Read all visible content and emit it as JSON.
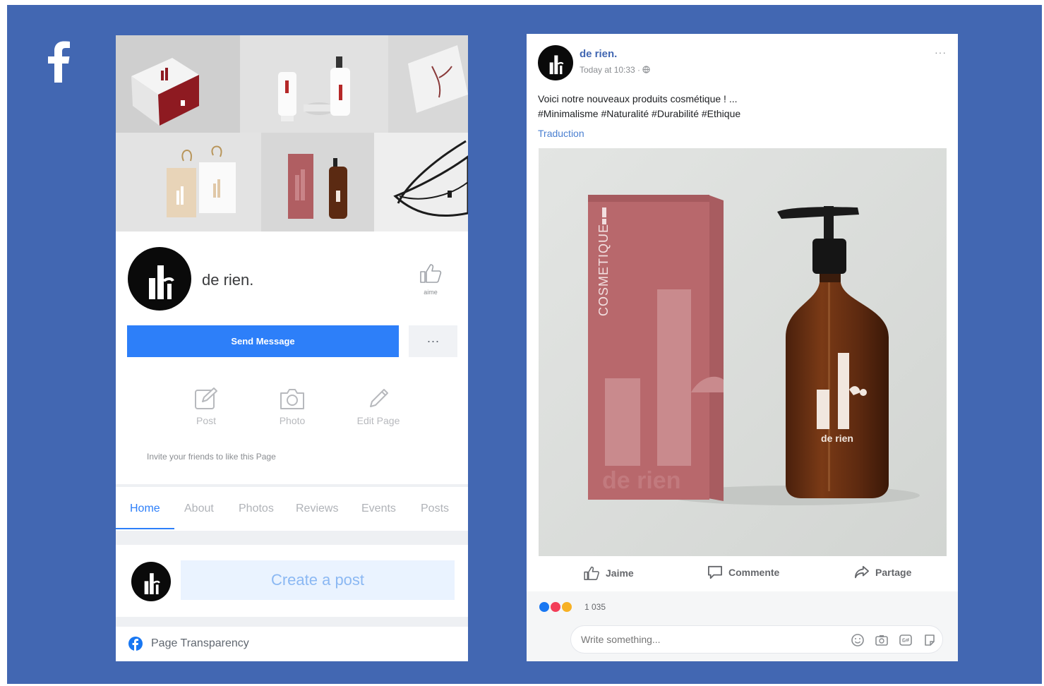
{
  "colors": {
    "facebook_blue": "#4267b2",
    "button_blue": "#2d7ff9",
    "create_post_bg": "#eaf3ff",
    "box_pink": "#b8686c",
    "bottle_amber": "#6b3214"
  },
  "page_card": {
    "name": "de rien.",
    "like_label": "aime",
    "send_message_label": "Send Message",
    "more_label": "···",
    "actions": [
      {
        "icon": "edit-icon",
        "label": "Post"
      },
      {
        "icon": "camera-icon",
        "label": "Photo"
      },
      {
        "icon": "pencil-icon",
        "label": "Edit Page"
      }
    ],
    "invite_text": "Invite your friends to like this Page",
    "tabs": [
      "Home",
      "About",
      "Photos",
      "Reviews",
      "Events",
      "Posts"
    ],
    "active_tab": "Home",
    "create_post_label": "Create a post",
    "transparency_label": "Page Transparency"
  },
  "post": {
    "author": "de rien.",
    "time": "Today at 10:33 · ",
    "caption_line1": "Voici notre nouveaux produits cosmétique ! ...",
    "caption_line2": "#Minimalisme #Naturalité #Durabilité #Ethique",
    "translate_label": "Traduction",
    "image": {
      "box_text": "COSMETIQUE",
      "box_brand": "de rien",
      "bottle_brand": "de rien"
    },
    "actions": [
      {
        "icon": "like-icon",
        "label": "Jaime"
      },
      {
        "icon": "comment-icon",
        "label": "Commente"
      },
      {
        "icon": "share-icon",
        "label": "Partage"
      }
    ],
    "reaction_count": "1 035",
    "comment_placeholder": "Write something..."
  }
}
